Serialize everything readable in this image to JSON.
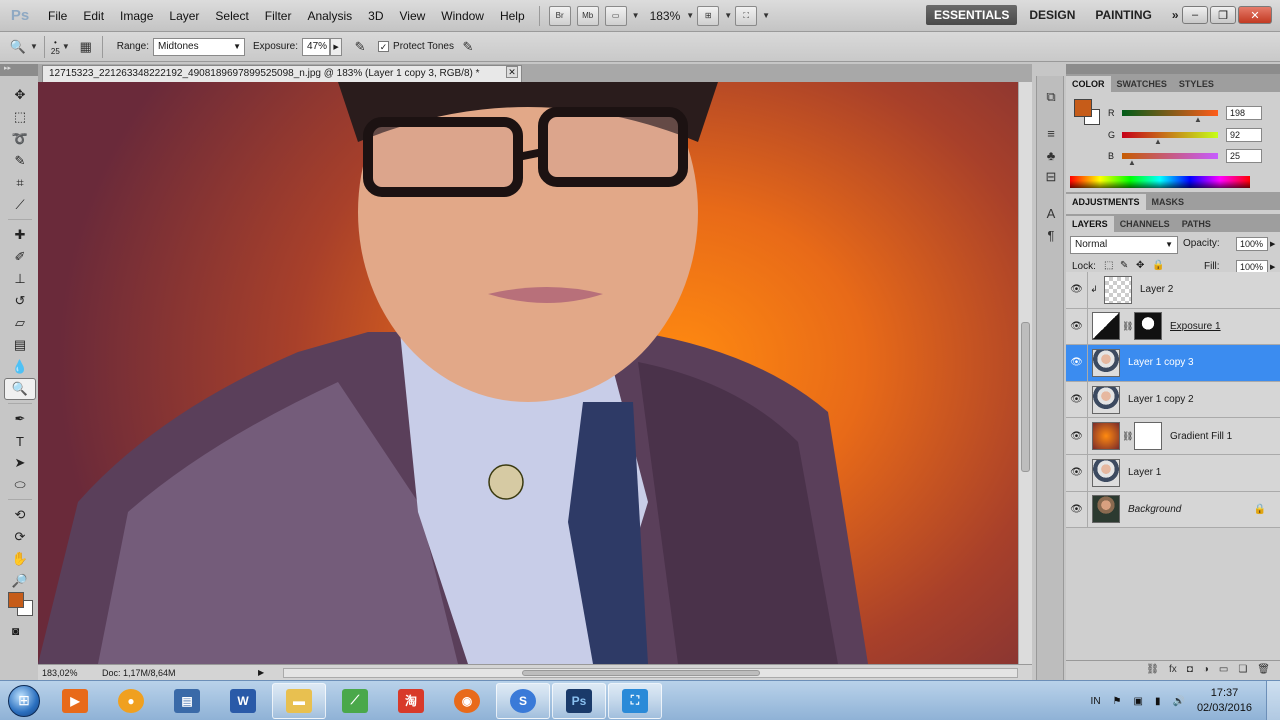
{
  "app": {
    "logo": "Ps"
  },
  "menu": [
    "File",
    "Edit",
    "Image",
    "Layer",
    "Select",
    "Filter",
    "Analysis",
    "3D",
    "View",
    "Window",
    "Help"
  ],
  "menubar_buttons": {
    "bridge": "Br",
    "minibridge": "Mb",
    "zoom_level": "183%"
  },
  "workspaces": [
    "ESSENTIALS",
    "DESIGN",
    "PAINTING"
  ],
  "workspaces_more": "»",
  "options": {
    "brush_size": "25",
    "range_label": "Range:",
    "range_value": "Midtones",
    "exposure_label": "Exposure:",
    "exposure_value": "47%",
    "protect_tones_label": "Protect Tones"
  },
  "document": {
    "tab_title": "12715323_221263348222192_4908189697899525098_n.jpg @ 183% (Layer 1 copy 3, RGB/8) *",
    "status_zoom": "183,02%",
    "status_doc": "Doc: 1,17M/8,64M"
  },
  "color_panel": {
    "tabs": [
      "COLOR",
      "SWATCHES",
      "STYLES"
    ],
    "channels": [
      {
        "label": "R",
        "value": "198"
      },
      {
        "label": "G",
        "value": "92"
      },
      {
        "label": "B",
        "value": "25"
      }
    ],
    "foreground": "#c65c19",
    "background": "#ffffff"
  },
  "adjustments_tabs": [
    "ADJUSTMENTS",
    "MASKS"
  ],
  "layers_panel": {
    "tabs": [
      "LAYERS",
      "CHANNELS",
      "PATHS"
    ],
    "blend_mode": "Normal",
    "opacity_label": "Opacity:",
    "opacity_value": "100%",
    "lock_label": "Lock:",
    "fill_label": "Fill:",
    "fill_value": "100%",
    "layers": [
      {
        "name": "Layer 2",
        "selected": false,
        "thumb": "checker",
        "clipped": true
      },
      {
        "name": "Exposure 1",
        "selected": false,
        "thumb": "adj",
        "mask": true,
        "style": "underline"
      },
      {
        "name": "Layer 1 copy 3",
        "selected": true,
        "thumb": "photo"
      },
      {
        "name": "Layer 1 copy 2",
        "selected": false,
        "thumb": "photo"
      },
      {
        "name": "Gradient Fill 1",
        "selected": false,
        "thumb": "gradient",
        "mask": true
      },
      {
        "name": "Layer 1",
        "selected": false,
        "thumb": "photo"
      },
      {
        "name": "Background",
        "selected": false,
        "thumb": "bgphoto",
        "style": "italic",
        "locked": true
      }
    ]
  },
  "taskbar": {
    "tray_lang": "IN",
    "time": "17:37",
    "date": "02/03/2016"
  }
}
